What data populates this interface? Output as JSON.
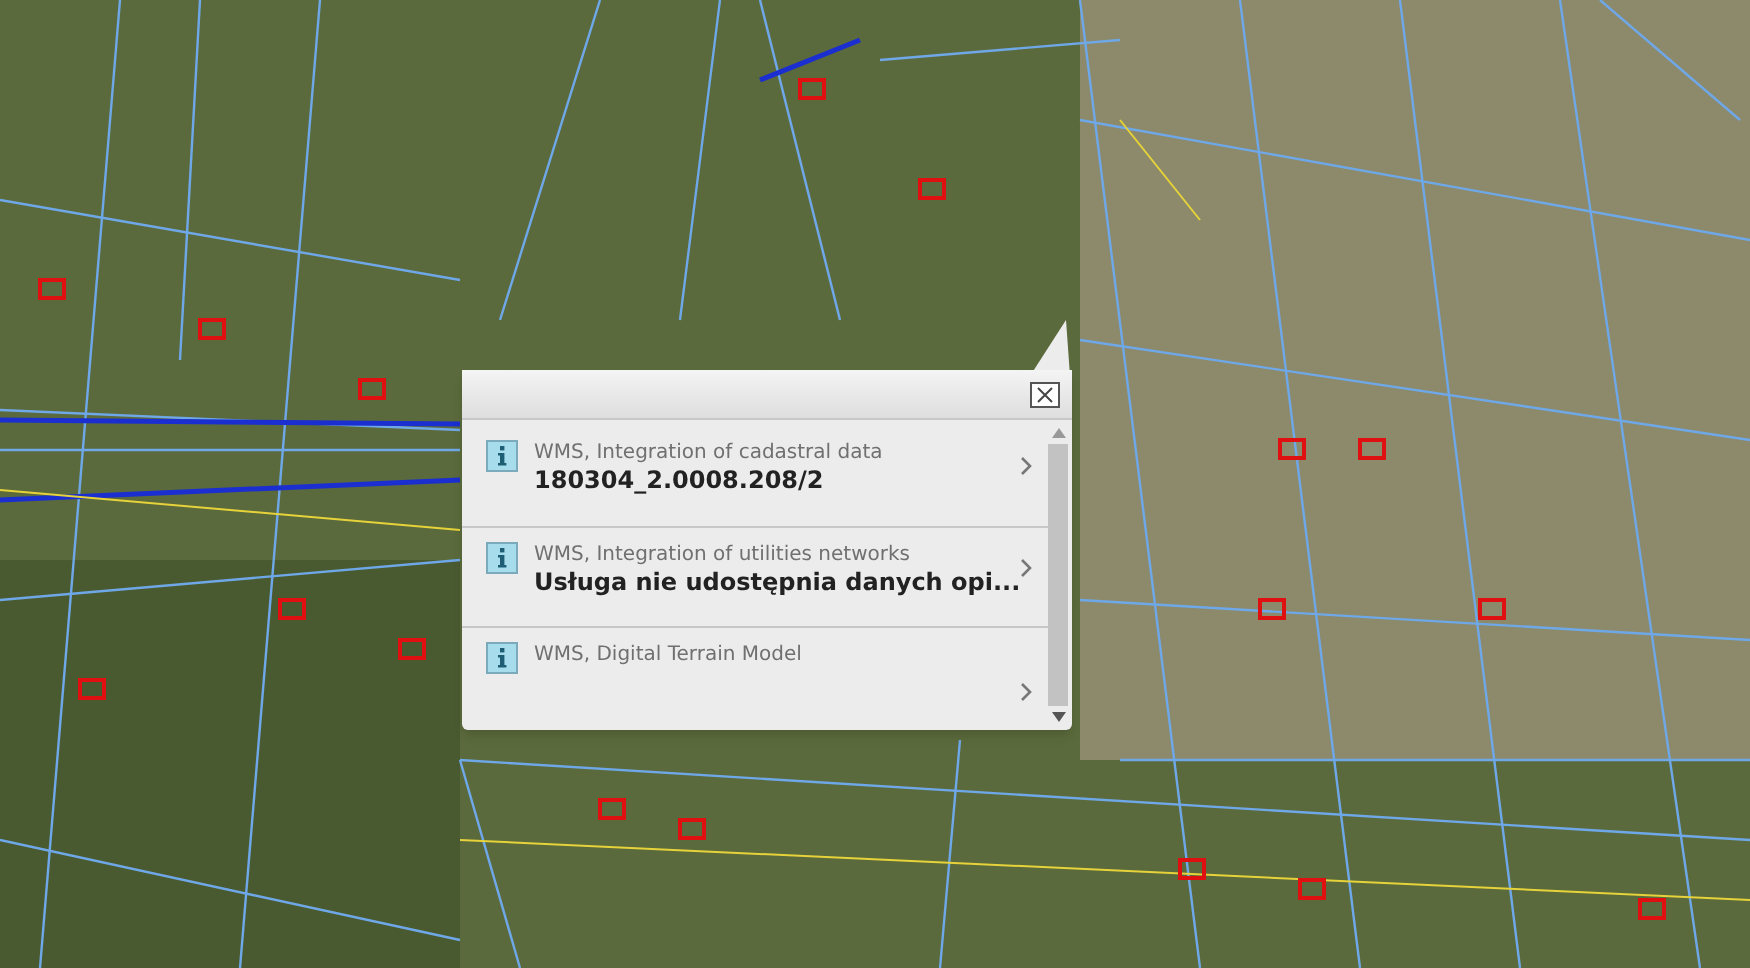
{
  "popup": {
    "items": [
      {
        "source": "WMS, Integration of cadastral data",
        "value": "180304_2.0008.208/2"
      },
      {
        "source": "WMS, Integration of utilities networks",
        "value": "Usługa nie udostępnia danych opi..."
      },
      {
        "source": "WMS, Digital Terrain Model"
      }
    ]
  }
}
